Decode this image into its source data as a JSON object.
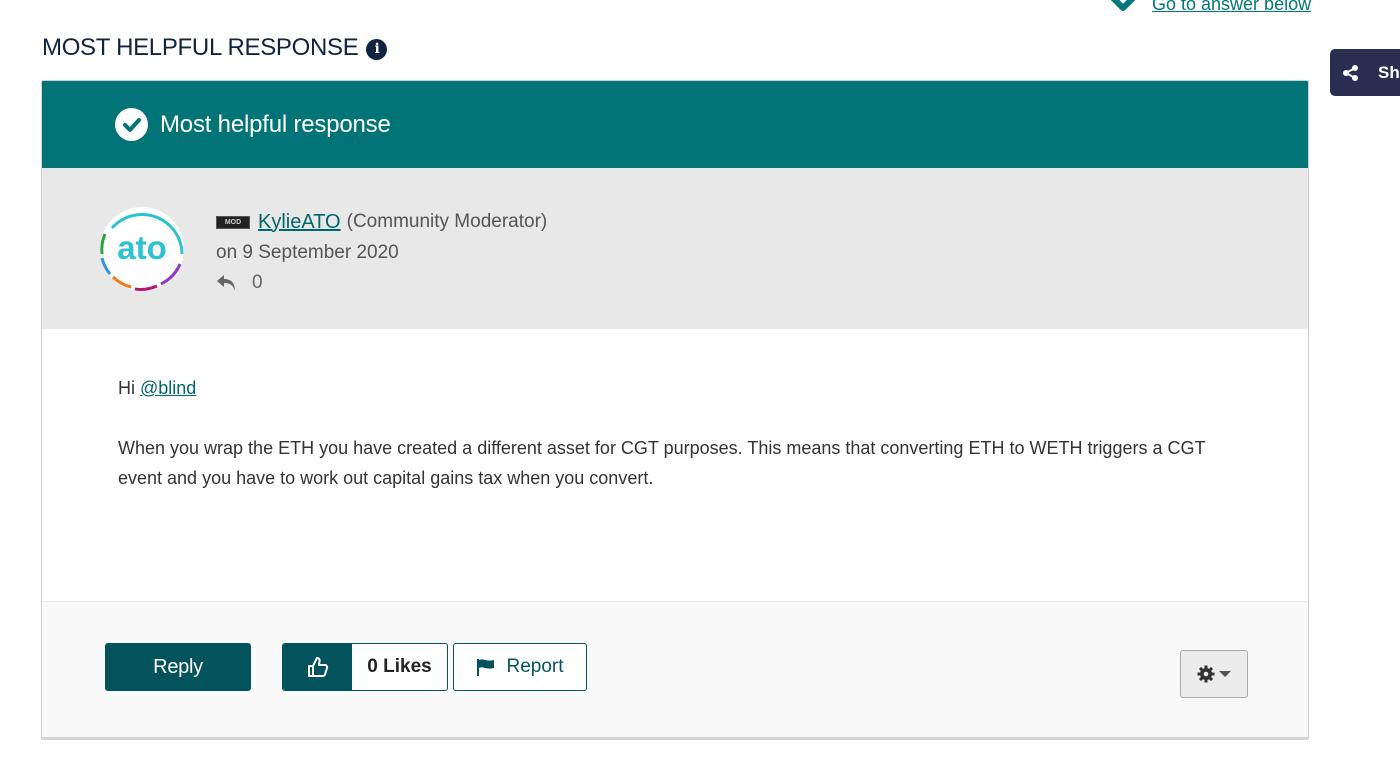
{
  "top_link": {
    "label": "Go to answer below",
    "icon": "arrow-down-icon"
  },
  "share": {
    "label": "Sh",
    "icon": "share-icon"
  },
  "section": {
    "title": "MOST HELPFUL RESPONSE",
    "info_icon": "info-icon"
  },
  "banner": {
    "label": "Most helpful response",
    "icon": "check-circle-icon",
    "color": "#017477"
  },
  "post": {
    "avatar_text": "ato",
    "badge": "MOD",
    "author": "KylieATO",
    "role": "(Community Moderator)",
    "date": "on 9 September 2020",
    "reply_count": "0",
    "greeting": "Hi ",
    "mention": "@blind",
    "body": "When you wrap the ETH you have created a different asset for CGT purposes. This means that converting ETH to WETH triggers a CGT event and you have to work out capital gains tax when you convert."
  },
  "actions": {
    "reply_label": "Reply",
    "likes_label": "0 Likes",
    "report_label": "Report",
    "options_icon": "gear-icon"
  },
  "colors": {
    "accent": "#017477",
    "button": "#03535c",
    "heading": "#0f2440",
    "share_bg": "#292e52"
  }
}
